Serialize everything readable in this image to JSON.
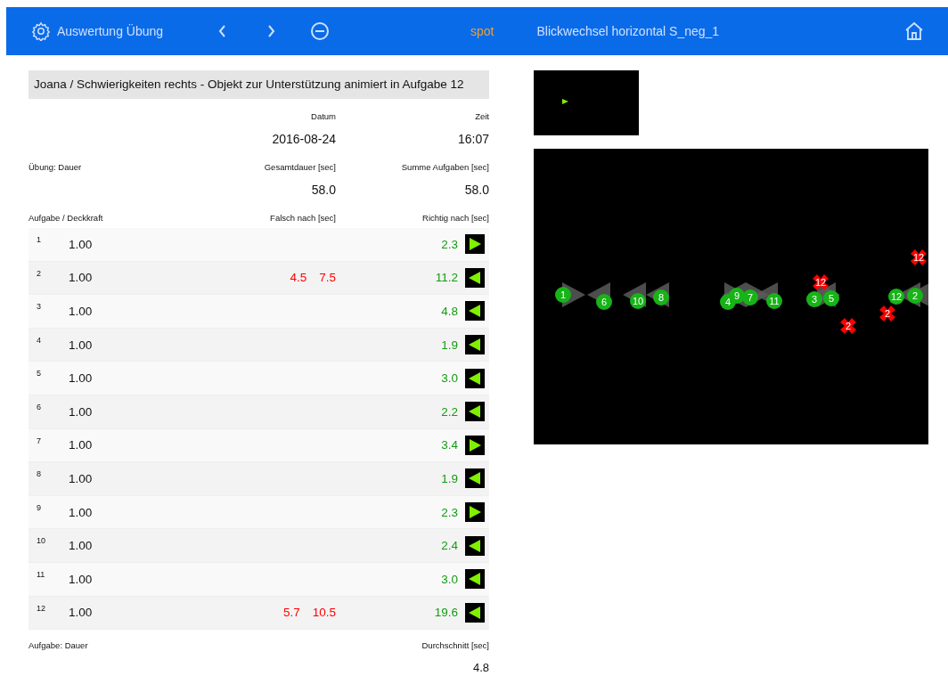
{
  "header": {
    "title": "Auswertung Übung",
    "mode": "spot",
    "exercise": "Blickwechsel horizontal S_neg_1"
  },
  "session_title": "Joana / Schwierigkeiten rechts - Objekt zur Unterstützung animiert in Aufgabe 12",
  "summary": [
    {
      "label": "Datum",
      "value": "2016-08-24"
    },
    {
      "label": "Zeit",
      "value": "16:07"
    }
  ],
  "duration": {
    "label": "Übung: Dauer",
    "columns": [
      {
        "label": "Gesamtdauer [sec]",
        "value": "58.0"
      },
      {
        "label": "Summe Aufgaben [sec]",
        "value": "58.0"
      }
    ]
  },
  "table": {
    "columns": [
      "Aufgabe / Deckkraft",
      "Falsch nach [sec]",
      "Richtig nach [sec]"
    ],
    "rows": [
      {
        "task": "1",
        "opacity": "1.00",
        "wrong": [],
        "correct": "2.3",
        "points_right": true
      },
      {
        "task": "2",
        "opacity": "1.00",
        "wrong": [
          "4.5",
          "7.5"
        ],
        "correct": "11.2",
        "points_right": false
      },
      {
        "task": "3",
        "opacity": "1.00",
        "wrong": [],
        "correct": "4.8",
        "points_right": false
      },
      {
        "task": "4",
        "opacity": "1.00",
        "wrong": [],
        "correct": "1.9",
        "points_right": false
      },
      {
        "task": "5",
        "opacity": "1.00",
        "wrong": [],
        "correct": "3.0",
        "points_right": false
      },
      {
        "task": "6",
        "opacity": "1.00",
        "wrong": [],
        "correct": "2.2",
        "points_right": false
      },
      {
        "task": "7",
        "opacity": "1.00",
        "wrong": [],
        "correct": "3.4",
        "points_right": true
      },
      {
        "task": "8",
        "opacity": "1.00",
        "wrong": [],
        "correct": "1.9",
        "points_right": false
      },
      {
        "task": "9",
        "opacity": "1.00",
        "wrong": [],
        "correct": "2.3",
        "points_right": true
      },
      {
        "task": "10",
        "opacity": "1.00",
        "wrong": [],
        "correct": "2.4",
        "points_right": false
      },
      {
        "task": "11",
        "opacity": "1.00",
        "wrong": [],
        "correct": "3.0",
        "points_right": false
      },
      {
        "task": "12",
        "opacity": "1.00",
        "wrong": [
          "5.7",
          "10.5"
        ],
        "correct": "19.6",
        "points_right": false
      }
    ]
  },
  "footer": {
    "label": "Aufgabe: Dauer",
    "average_label": "Durchschnitt [sec]",
    "average": "4.8"
  },
  "canvas": {
    "markers": [
      {
        "label": "1",
        "kind": "hit"
      },
      {
        "label": "6",
        "kind": "hit"
      },
      {
        "label": "10",
        "kind": "hit"
      },
      {
        "label": "8",
        "kind": "hit"
      },
      {
        "label": "4",
        "kind": "hit"
      },
      {
        "label": "9",
        "kind": "hit"
      },
      {
        "label": "7",
        "kind": "hit"
      },
      {
        "label": "11",
        "kind": "hit"
      },
      {
        "label": "3",
        "kind": "hit"
      },
      {
        "label": "5",
        "kind": "hit"
      },
      {
        "label": "12",
        "kind": "hit"
      },
      {
        "label": "2",
        "kind": "hit"
      },
      {
        "label": "12",
        "kind": "miss"
      },
      {
        "label": "12",
        "kind": "miss"
      },
      {
        "label": "2",
        "kind": "miss"
      },
      {
        "label": "2",
        "kind": "miss"
      }
    ]
  }
}
